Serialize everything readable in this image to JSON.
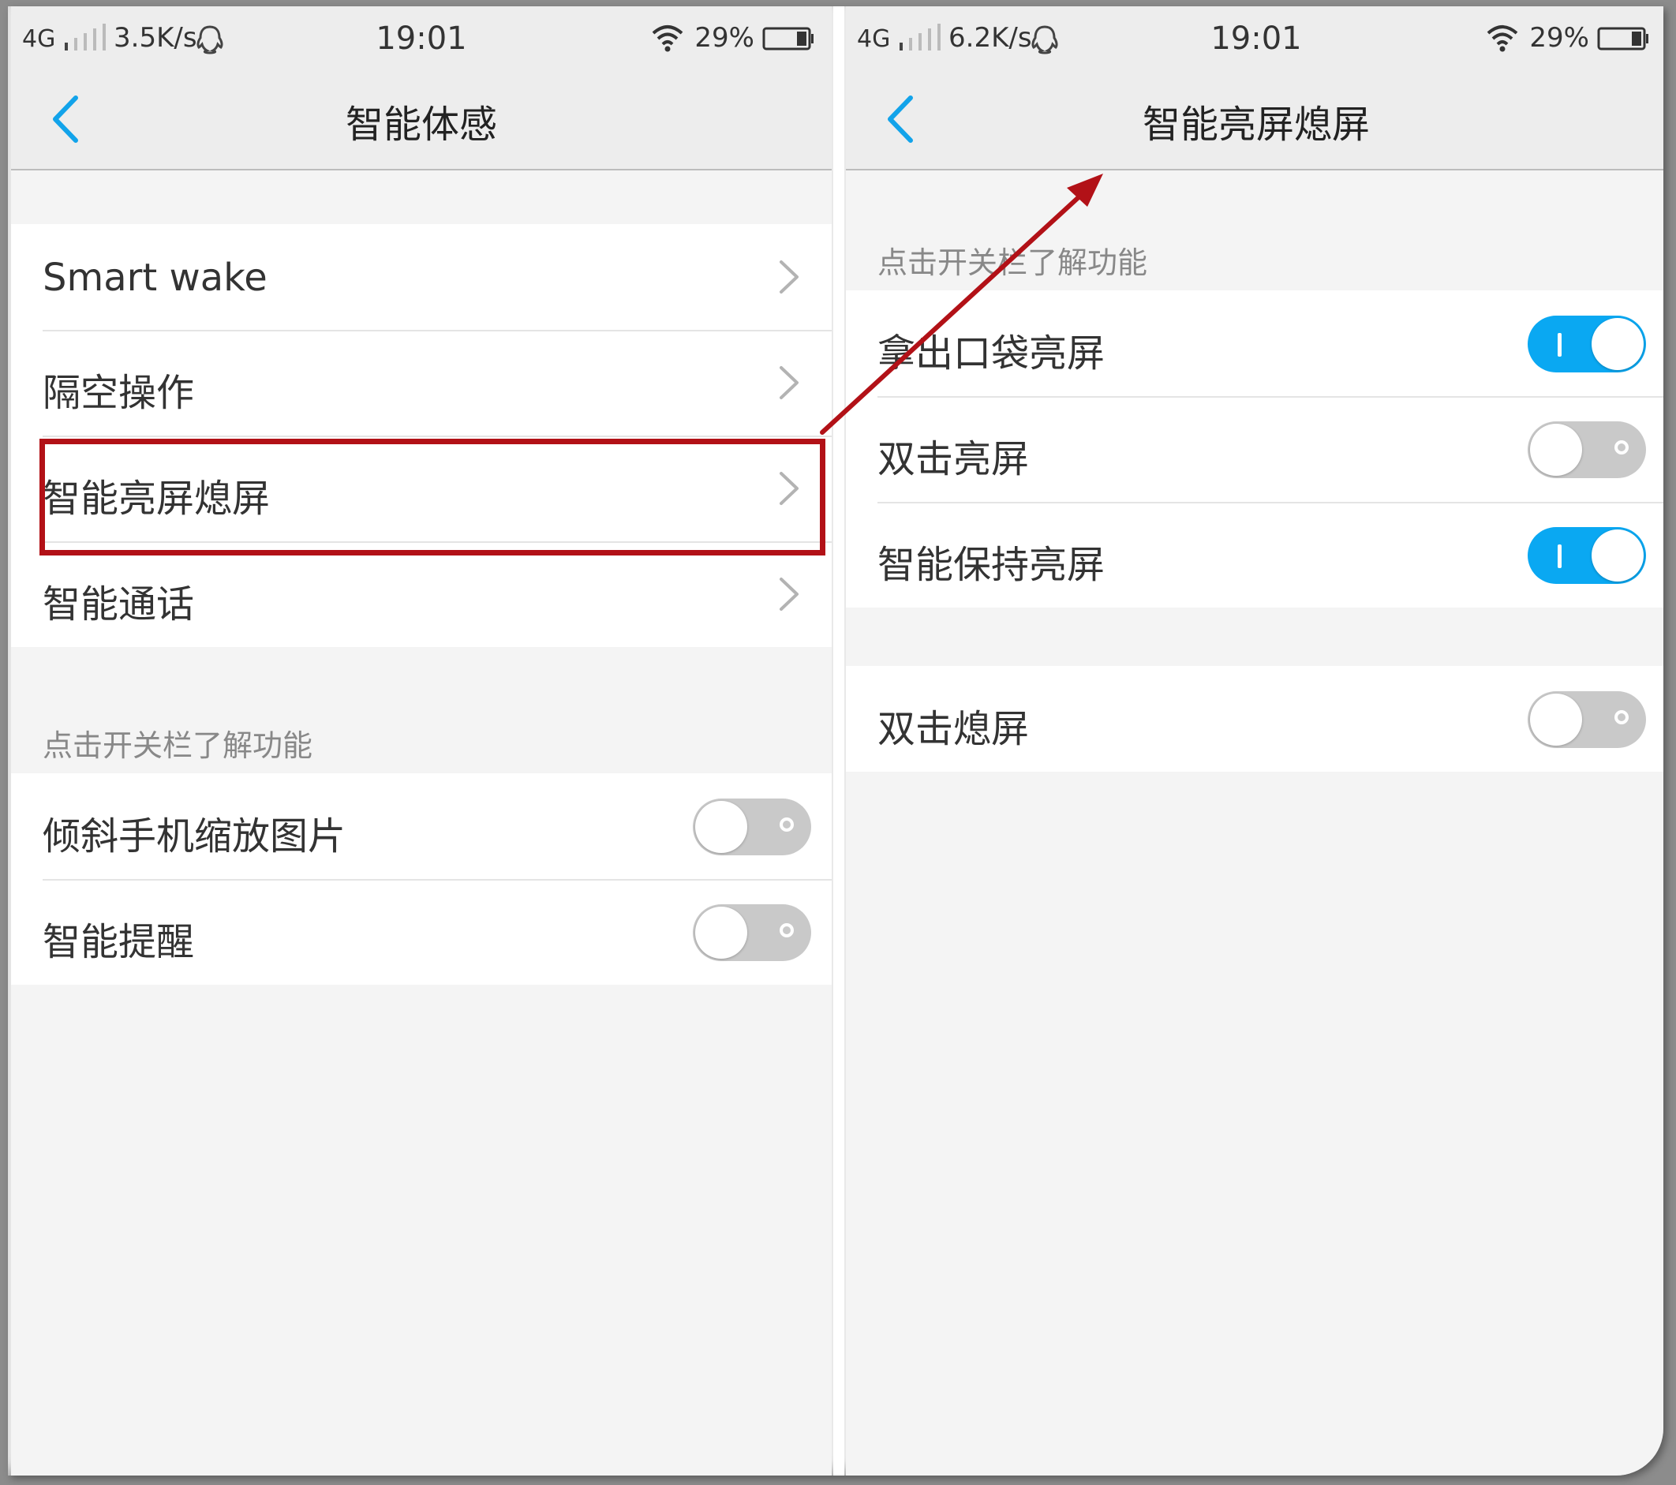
{
  "colors": {
    "accent": "#0aa8f2",
    "toggle_off": "#c9c9c9",
    "annotation_red": "#b21117"
  },
  "left_screen": {
    "status_bar": {
      "network": "4G",
      "speed": "3.5K/s",
      "time": "19:01",
      "battery_percent": "29%",
      "icons": [
        "signal-icon",
        "qq-icon",
        "wifi-icon",
        "battery-icon"
      ]
    },
    "title": "智能体感",
    "nav_items": [
      {
        "label": "Smart wake",
        "icon": "chevron-right-icon"
      },
      {
        "label": "隔空操作",
        "icon": "chevron-right-icon"
      },
      {
        "label": "智能亮屏熄屏",
        "icon": "chevron-right-icon",
        "highlighted": true
      },
      {
        "label": "智能通话",
        "icon": "chevron-right-icon"
      }
    ],
    "section_note": "点击开关栏了解功能",
    "toggle_items": [
      {
        "label": "倾斜手机缩放图片",
        "state": "off"
      },
      {
        "label": "智能提醒",
        "state": "off"
      }
    ]
  },
  "right_screen": {
    "status_bar": {
      "network": "4G",
      "speed": "6.2K/s",
      "time": "19:01",
      "battery_percent": "29%",
      "icons": [
        "signal-icon",
        "qq-icon",
        "wifi-icon",
        "battery-icon"
      ]
    },
    "title": "智能亮屏熄屏",
    "section_note": "点击开关栏了解功能",
    "toggle_group_1": [
      {
        "label": "拿出口袋亮屏",
        "state": "on"
      },
      {
        "label": "双击亮屏",
        "state": "off"
      },
      {
        "label": "智能保持亮屏",
        "state": "on"
      }
    ],
    "toggle_group_2": [
      {
        "label": "双击熄屏",
        "state": "off"
      }
    ]
  }
}
